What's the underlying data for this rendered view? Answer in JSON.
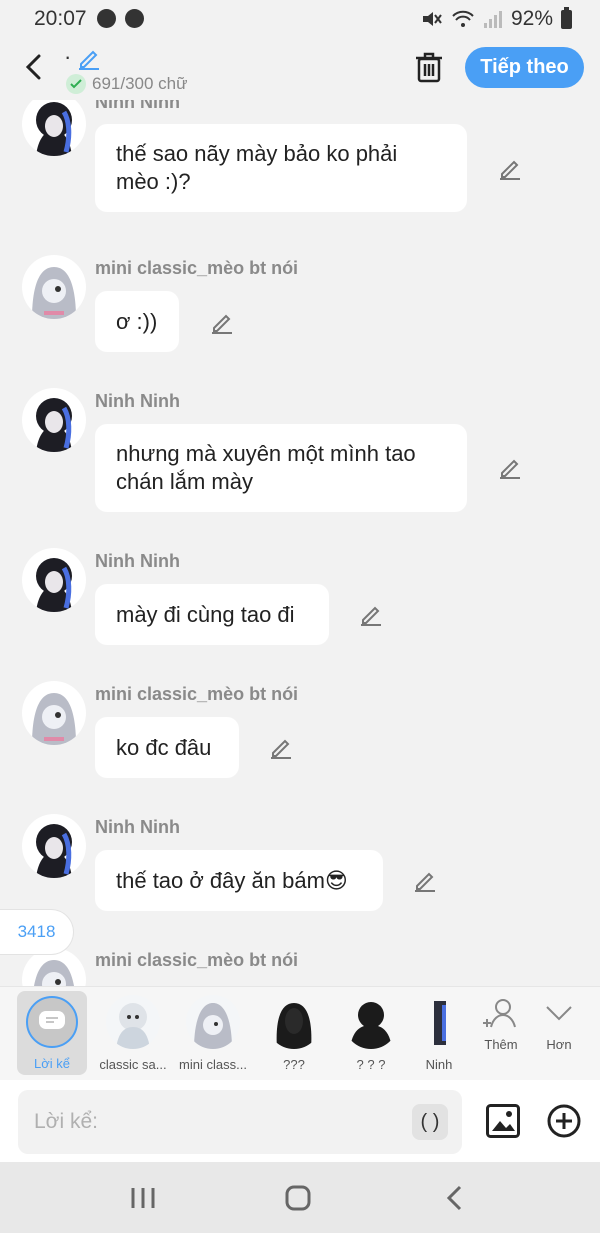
{
  "status": {
    "time": "20:07",
    "battery": "92%"
  },
  "header": {
    "title_dot": "·",
    "char_count": "691/300 chữ",
    "next_label": "Tiếp theo"
  },
  "messages": [
    {
      "sender": "Ninh Ninh",
      "text_lines": [
        "thế sao nãy mày bảo ko phải",
        "mèo :)?"
      ]
    },
    {
      "sender": "mini classic_mèo bt nói",
      "text_lines": [
        "ơ :))"
      ]
    },
    {
      "sender": "Ninh Ninh",
      "text_lines": [
        "nhưng mà xuyên một mình tao",
        "chán lắm mày"
      ]
    },
    {
      "sender": "Ninh Ninh",
      "text_lines": [
        "mày đi cùng tao đi"
      ]
    },
    {
      "sender": "mini classic_mèo bt nói",
      "text_lines": [
        "ko đc đâu"
      ]
    },
    {
      "sender": "Ninh Ninh",
      "text_lines": [
        "thế tao ở đây ăn bám😎"
      ]
    },
    {
      "sender": "mini classic_mèo bt nói",
      "text_lines": []
    }
  ],
  "counter": "3418",
  "characters": {
    "narrator": "Lời kể",
    "items": [
      "classic sa...",
      "mini class...",
      "???",
      "? ? ?",
      "Ninh"
    ],
    "add_label": "Thêm",
    "more_label": "Hơn"
  },
  "input": {
    "placeholder": "Lời kể:",
    "paren": "( )"
  },
  "colors": {
    "accent": "#4a9ff5",
    "bubble": "#ffffff",
    "background": "#f2f2f2"
  }
}
